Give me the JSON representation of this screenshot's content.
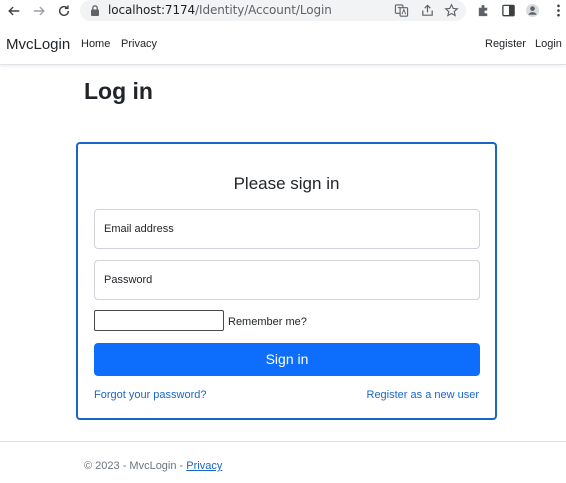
{
  "browser": {
    "url_host": "localhost:7174",
    "url_path": "/Identity/Account/Login"
  },
  "navbar": {
    "brand": "MvcLogin",
    "links": [
      "Home",
      "Privacy"
    ],
    "right_links": [
      "Register",
      "Login"
    ]
  },
  "page": {
    "title": "Log in"
  },
  "form": {
    "heading": "Please sign in",
    "email_placeholder": "Email address",
    "password_placeholder": "Password",
    "remember_label": "Remember me?",
    "submit_label": "Sign in",
    "forgot_link": "Forgot your password?",
    "register_link": "Register as a new user"
  },
  "footer": {
    "text": "© 2023 - MvcLogin - ",
    "privacy_link": "Privacy"
  },
  "colors": {
    "primary": "#0d6efd",
    "link": "#1a66c7",
    "card_border": "#1a66c7"
  }
}
